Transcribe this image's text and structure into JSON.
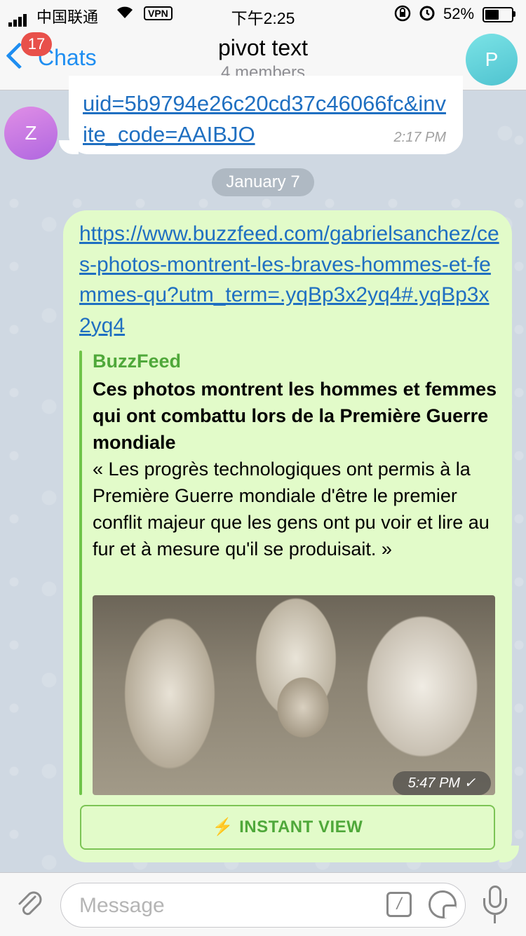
{
  "status_bar": {
    "carrier": "中国联通",
    "vpn": "VPN",
    "time": "下午2:25",
    "battery_percent_label": "52%",
    "battery_level": 0.52
  },
  "nav": {
    "back_label": "Chats",
    "unread_count": "17",
    "title": "pivot text",
    "subtitle": "4 members",
    "avatar_letter": "P"
  },
  "messages": {
    "incoming": {
      "avatar_letter": "Z",
      "link_text": "uid=5b9794e26c20cd37c46066fc&invite_code=AAIBJO",
      "time": "2:17 PM"
    },
    "date_separator": "January 7",
    "outgoing": {
      "link_text": "https://www.buzzfeed.com/gabrielsanchez/ces-photos-montrent-les-braves-hommes-et-femmes-qu?utm_term=.yqBp3x2yq4#.yqBp3x2yq4",
      "preview": {
        "site_name": "BuzzFeed",
        "title": "Ces photos montrent les hommes et femmes qui ont combattu lors de la Première Guerre mondiale",
        "description": "« Les progrès technologiques ont permis à la Première Guerre mondiale d'être le premier conflit majeur que les gens ont pu voir et lire au fur et à mesure qu'il se produisait. »"
      },
      "time": "5:47 PM",
      "read_mark": "✓",
      "instant_view_label": "INSTANT VIEW"
    }
  },
  "input_bar": {
    "placeholder": "Message"
  },
  "colors": {
    "accent_blue": "#1f8ef1",
    "link_blue": "#1f6fc1",
    "outgoing_bubble": "#e2fbc9",
    "preview_green": "#4fa83a",
    "badge_red": "#e8504a"
  },
  "icons": [
    "signal-icon",
    "wifi-icon",
    "lock-rotation-icon",
    "alarm-icon",
    "battery-icon",
    "chevron-left-icon",
    "bolt-icon",
    "paperclip-icon",
    "commands-icon",
    "sticker-icon",
    "microphone-icon"
  ]
}
